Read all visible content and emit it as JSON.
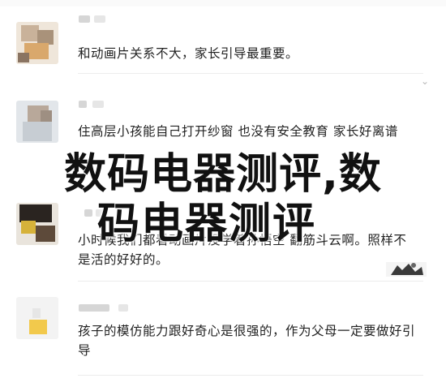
{
  "comments": [
    {
      "text": "和动画片关系不大，家长引导最重要。"
    },
    {
      "text": "住高层小孩能自己打开纱窗 也没有安全教育 家长好离谱"
    },
    {
      "text": "小时候我们都看动画片没学着孙悟空 翻筋斗云啊。照样不是活的好好的。"
    },
    {
      "text": "孩子的模仿能力跟好奇心是很强的，作为父母一定要做好引导"
    }
  ],
  "watermark": {
    "line1": "数码电器测评,数",
    "line2": "码电器测评"
  },
  "colors": {
    "separator": "#ececec",
    "meta": "#d6d6d6",
    "text": "#222222",
    "watermark": "#111111"
  }
}
